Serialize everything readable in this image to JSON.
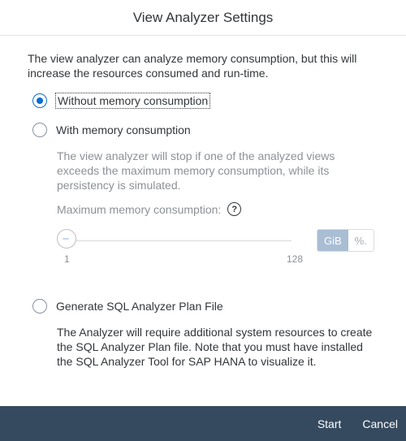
{
  "dialog": {
    "title": "View Analyzer Settings",
    "intro": "The view analyzer can analyze memory consumption, but this will increase the resources consumed and run-time."
  },
  "options": {
    "without_memory": {
      "label": "Without memory consumption",
      "selected": true
    },
    "with_memory": {
      "label": "With memory consumption",
      "selected": false,
      "description": "The view analyzer will stop if one of the analyzed views exceeds the maximum memory consumption, while its persistency is simulated.",
      "max_label": "Maximum memory consumption:",
      "slider": {
        "min": "1",
        "max": "128",
        "value": 1
      },
      "units": {
        "active": "GiB",
        "inactive": "%."
      }
    },
    "sql_plan": {
      "label": "Generate SQL Analyzer Plan File",
      "selected": false,
      "description": "The Analyzer will require additional system resources to create the SQL Analyzer Plan file. Note that you must have installed the SQL Analyzer Tool for SAP HANA to visualize it."
    }
  },
  "footer": {
    "start": "Start",
    "cancel": "Cancel"
  },
  "colors": {
    "accent": "#0a6ed1",
    "footer_bg": "#354a5f",
    "unit_active_bg": "#a9bdd3"
  },
  "icons": {
    "help": "question-icon"
  },
  "help_glyph": "?"
}
